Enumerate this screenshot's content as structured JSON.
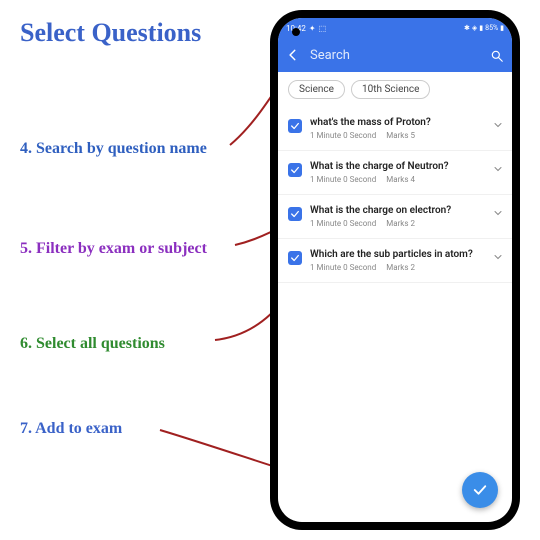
{
  "title": "Select Questions",
  "annotations": {
    "a4": "4. Search by question name",
    "a5": "5. Filter by exam or subject",
    "a6": "6. Select all questions",
    "a7": "7. Add to exam"
  },
  "status": {
    "time": "10:42",
    "battery": "85%"
  },
  "appbar": {
    "search_placeholder": "Search"
  },
  "filters": {
    "f1": "Science",
    "f2": "10th Science"
  },
  "questions": [
    {
      "title": "what's the mass of Proton?",
      "time": "1 Minute 0 Second",
      "marks": "Marks 5"
    },
    {
      "title": "What is the charge of Neutron?",
      "time": "1 Minute 0 Second",
      "marks": "Marks 4"
    },
    {
      "title": "What is the charge on electron?",
      "time": "1 Minute 0 Second",
      "marks": "Marks 2"
    },
    {
      "title": "Which are the sub particles in atom?",
      "time": "1 Minute 0 Second",
      "marks": "Marks 2"
    }
  ]
}
